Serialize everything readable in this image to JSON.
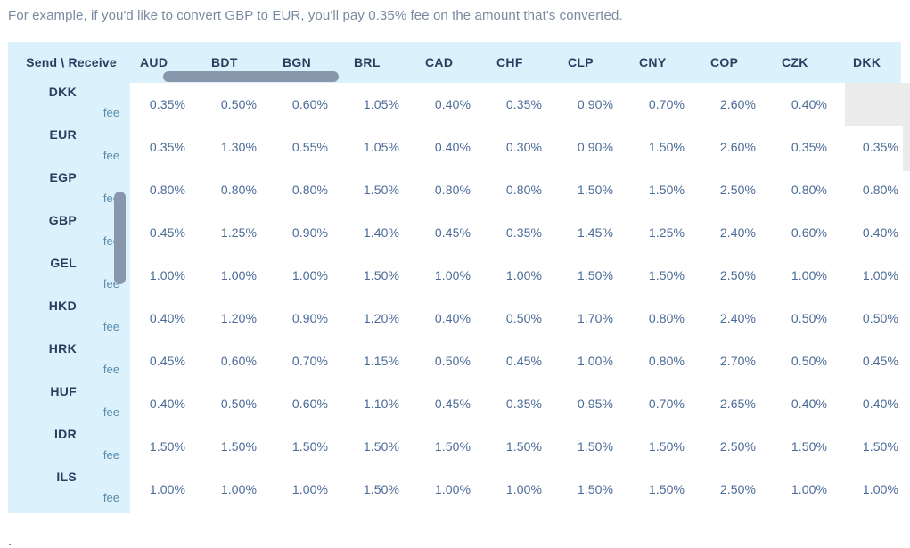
{
  "intro": {
    "text": "For example, if you'd like to convert GBP to EUR, you'll pay 0.35% fee on the amount that's converted."
  },
  "table": {
    "corner_label": "Send \\ Receive",
    "row_sub_label": "fee",
    "blank_cell_value": "",
    "columns": [
      "AUD",
      "BDT",
      "BGN",
      "BRL",
      "CAD",
      "CHF",
      "CLP",
      "CNY",
      "COP",
      "CZK",
      "DKK"
    ],
    "rows": [
      "DKK",
      "EUR",
      "EGP",
      "GBP",
      "GEL",
      "HKD",
      "HRK",
      "HUF",
      "IDR",
      "ILS"
    ],
    "values": [
      [
        "0.35%",
        "0.50%",
        "0.60%",
        "1.05%",
        "0.40%",
        "0.35%",
        "0.90%",
        "0.70%",
        "2.60%",
        "0.40%",
        ""
      ],
      [
        "0.35%",
        "1.30%",
        "0.55%",
        "1.05%",
        "0.40%",
        "0.30%",
        "0.90%",
        "1.50%",
        "2.60%",
        "0.35%",
        "0.35%"
      ],
      [
        "0.80%",
        "0.80%",
        "0.80%",
        "1.50%",
        "0.80%",
        "0.80%",
        "1.50%",
        "1.50%",
        "2.50%",
        "0.80%",
        "0.80%"
      ],
      [
        "0.45%",
        "1.25%",
        "0.90%",
        "1.40%",
        "0.45%",
        "0.35%",
        "1.45%",
        "1.25%",
        "2.40%",
        "0.60%",
        "0.40%"
      ],
      [
        "1.00%",
        "1.00%",
        "1.00%",
        "1.50%",
        "1.00%",
        "1.00%",
        "1.50%",
        "1.50%",
        "2.50%",
        "1.00%",
        "1.00%"
      ],
      [
        "0.40%",
        "1.20%",
        "0.90%",
        "1.20%",
        "0.40%",
        "0.50%",
        "1.70%",
        "0.80%",
        "2.40%",
        "0.50%",
        "0.50%"
      ],
      [
        "0.45%",
        "0.60%",
        "0.70%",
        "1.15%",
        "0.50%",
        "0.45%",
        "1.00%",
        "0.80%",
        "2.70%",
        "0.50%",
        "0.45%"
      ],
      [
        "0.40%",
        "0.50%",
        "0.60%",
        "1.10%",
        "0.45%",
        "0.35%",
        "0.95%",
        "0.70%",
        "2.65%",
        "0.40%",
        "0.40%"
      ],
      [
        "1.50%",
        "1.50%",
        "1.50%",
        "1.50%",
        "1.50%",
        "1.50%",
        "1.50%",
        "1.50%",
        "2.50%",
        "1.50%",
        "1.50%"
      ],
      [
        "1.00%",
        "1.00%",
        "1.00%",
        "1.50%",
        "1.00%",
        "1.00%",
        "1.50%",
        "1.50%",
        "2.50%",
        "1.00%",
        "1.00%"
      ]
    ]
  },
  "colors": {
    "header_background": "#dbf1fb",
    "header_text": "#2a3f5f",
    "cell_text": "#4a6a97",
    "intro_text": "#7b8aa0",
    "scrollbar_thumb": "#8897ab",
    "blank_cell": "#ebebeb"
  },
  "bottom_fragment": {
    "text": "."
  }
}
